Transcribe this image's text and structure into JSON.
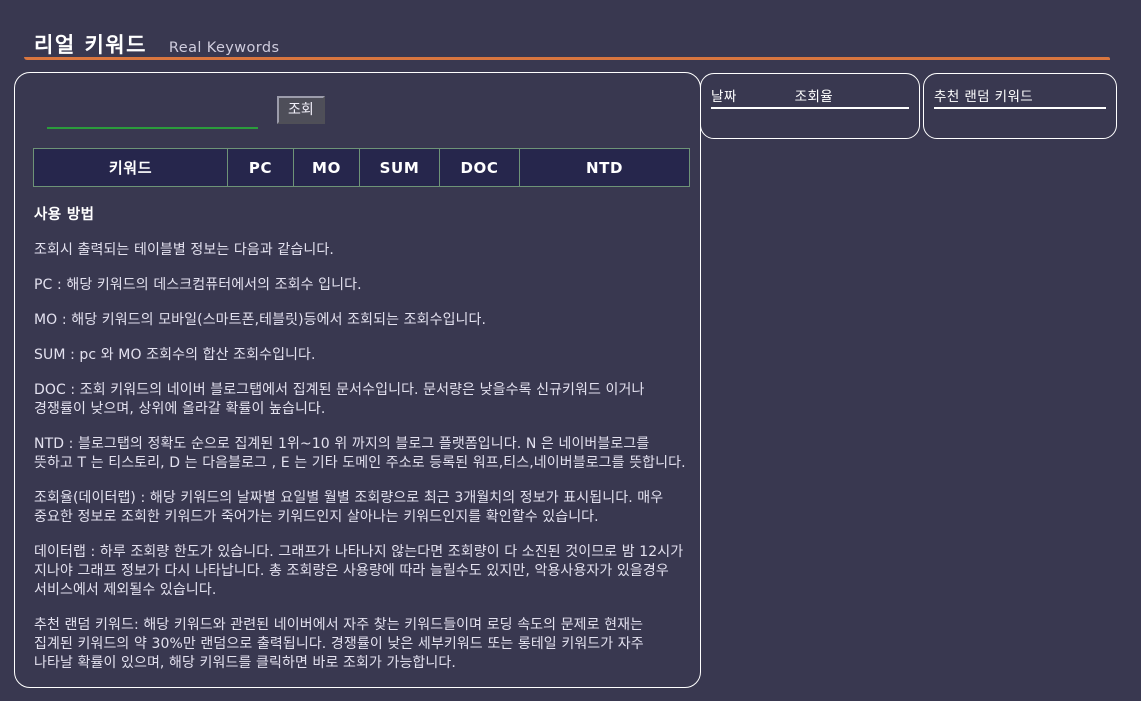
{
  "header": {
    "brand_ko": "리얼 키워드",
    "brand_en": "Real Keywords",
    "accent_color": "#d9763f"
  },
  "search": {
    "input_value": "",
    "placeholder": "",
    "button_label": "조회",
    "underline_color": "#2b9c3c"
  },
  "result_table": {
    "columns": [
      {
        "key": "keyword",
        "label": "키워드"
      },
      {
        "key": "pc",
        "label": "PC"
      },
      {
        "key": "mo",
        "label": "MO"
      },
      {
        "key": "sum",
        "label": "SUM"
      },
      {
        "key": "doc",
        "label": "DOC"
      },
      {
        "key": "ntd",
        "label": "NTD"
      }
    ],
    "rows": [],
    "border_color": "#6e9377",
    "header_bg": "#26264c"
  },
  "usage": {
    "title": "사용 방법",
    "paragraphs": [
      "조회시 출력되는 테이블별 정보는 다음과 같습니다.",
      "PC : 해당 키워드의 데스크컴퓨터에서의 조회수 입니다.",
      "MO : 해당 키워드의 모바일(스마트폰,테블릿)등에서 조회되는 조회수입니다.",
      "SUM : pc 와 MO 조회수의 합산 조회수입니다.",
      "DOC : 조회 키워드의 네이버 블로그탭에서 집계된 문서수입니다. 문서량은 낮을수록 신규키워드 이거나 경쟁률이 낮으며, 상위에 올라갈 확률이 높습니다.",
      "NTD : 블로그탭의 정확도 순으로 집계된 1위~10 위 까지의 블로그 플랫폼입니다. N 은 네이버블로그를 뜻하고 T 는 티스토리, D 는 다음블로그 , E 는 기타 도메인 주소로 등록된 워프,티스,네이버블로그를 뜻합니다.",
      "조회율(데이터랩) : 해당 키워드의 날짜별 요일별 월별 조회량으로 최근 3개월치의 정보가 표시됩니다. 매우 중요한 정보로 조회한 키워드가 죽어가는 키워드인지 살아나는 키워드인지를 확인할수 있습니다.",
      "데이터랩 : 하루 조회량 한도가 있습니다. 그래프가 나타나지 않는다면 조회량이 다 소진된 것이므로 밤 12시가 지나야 그래프 정보가 다시 나타납니다. 총 조회량은 사용량에 따라 늘릴수도 있지만, 악용사용자가 있을경우 서비스에서 제외될수 있습니다.",
      "추천 랜덤 키워드: 해당 키워드와 관련된 네이버에서 자주 찾는 키워드들이며 로딩 속도의 문제로 현재는 집계된 키워드의 약 30%만 랜덤으로 출력됩니다. 경쟁률이 낮은 세부키워드 또는 롱테일 키워드가 자주 나타날 확률이 있으며, 해당 키워드를 클릭하면 바로 조회가 가능합니다."
    ]
  },
  "side_panels": {
    "chart": {
      "col_date": "날짜",
      "col_rate": "조회율",
      "rows": []
    },
    "random": {
      "title": "추천 랜덤 키워드",
      "items": []
    }
  }
}
